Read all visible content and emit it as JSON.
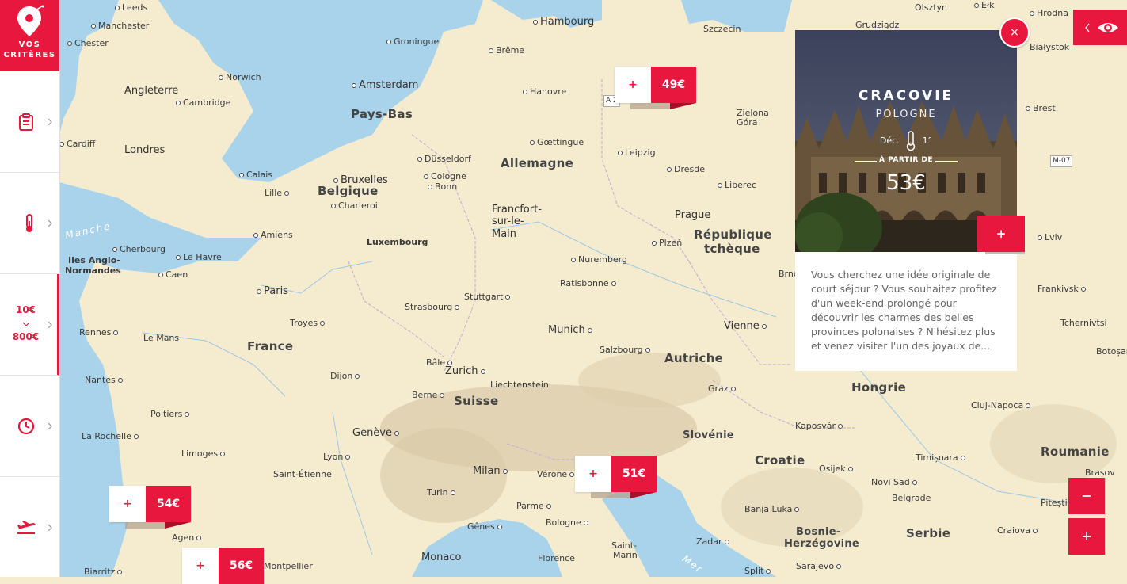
{
  "brand": {
    "line1": "VOS",
    "line2": "CRITÈRES"
  },
  "sidebar": {
    "items": [
      {
        "name": "clipboard-icon"
      },
      {
        "name": "thermometer-icon"
      },
      {
        "name": "price-range",
        "min": "10€",
        "max": "800€"
      },
      {
        "name": "clock-icon"
      },
      {
        "name": "plane-icon"
      }
    ]
  },
  "map": {
    "labels": [
      {
        "text": "Leeds",
        "type": "city"
      },
      {
        "text": "Manchester",
        "type": "city"
      },
      {
        "text": "Chester",
        "type": "city"
      },
      {
        "text": "Norwich",
        "type": "city"
      },
      {
        "text": "Angleterre",
        "type": "city-lg"
      },
      {
        "text": "Cambridge",
        "type": "city"
      },
      {
        "text": "Cardiff",
        "type": "city"
      },
      {
        "text": "Londres",
        "type": "city-lg"
      },
      {
        "text": "Calais",
        "type": "city"
      },
      {
        "text": "Lille",
        "type": "city"
      },
      {
        "text": "Manche",
        "type": "sea"
      },
      {
        "text": "Amiens",
        "type": "city"
      },
      {
        "text": "Cherbourg",
        "type": "city"
      },
      {
        "text": "Le Havre",
        "type": "city"
      },
      {
        "text": "Iles Anglo-",
        "type": "city"
      },
      {
        "text": "Normandes",
        "type": "city"
      },
      {
        "text": "Caen",
        "type": "city"
      },
      {
        "text": "Paris",
        "type": "city-lg"
      },
      {
        "text": "Rennes",
        "type": "city"
      },
      {
        "text": "Le Mans",
        "type": "city"
      },
      {
        "text": "Troyes",
        "type": "city"
      },
      {
        "text": "France",
        "type": "country"
      },
      {
        "text": "Nantes",
        "type": "city"
      },
      {
        "text": "Dijon",
        "type": "city"
      },
      {
        "text": "Poitiers",
        "type": "city"
      },
      {
        "text": "La Rochelle",
        "type": "city"
      },
      {
        "text": "Limoges",
        "type": "city"
      },
      {
        "text": "Lyon",
        "type": "city"
      },
      {
        "text": "Saint-Étienne",
        "type": "city"
      },
      {
        "text": "Agen",
        "type": "city"
      },
      {
        "text": "Biarritz",
        "type": "city"
      },
      {
        "text": "Montpellier",
        "type": "city"
      },
      {
        "text": "Groningue",
        "type": "city"
      },
      {
        "text": "Amsterdam",
        "type": "city-lg"
      },
      {
        "text": "Pays-Bas",
        "type": "country"
      },
      {
        "text": "Bruxelles",
        "type": "city-lg"
      },
      {
        "text": "Belgique",
        "type": "country"
      },
      {
        "text": "Charleroi",
        "type": "city"
      },
      {
        "text": "Luxembourg",
        "type": "city"
      },
      {
        "text": "Hambourg",
        "type": "city-lg"
      },
      {
        "text": "Brême",
        "type": "city"
      },
      {
        "text": "Hanovre",
        "type": "city"
      },
      {
        "text": "Gœttingue",
        "type": "city"
      },
      {
        "text": "Düsseldorf",
        "type": "city"
      },
      {
        "text": "Cologne",
        "type": "city"
      },
      {
        "text": "Bonn",
        "type": "city"
      },
      {
        "text": "Allemagne",
        "type": "country"
      },
      {
        "text": "Francfort-",
        "type": "city-lg"
      },
      {
        "text": "sur-le-",
        "type": "city-lg"
      },
      {
        "text": "Main",
        "type": "city-lg"
      },
      {
        "text": "Leipzig",
        "type": "city"
      },
      {
        "text": "Dresde",
        "type": "city"
      },
      {
        "text": "Nuremberg",
        "type": "city"
      },
      {
        "text": "Stuttgart",
        "type": "city"
      },
      {
        "text": "Strasbourg",
        "type": "city"
      },
      {
        "text": "Ratisbonne",
        "type": "city"
      },
      {
        "text": "Munich",
        "type": "city-lg"
      },
      {
        "text": "Salzbourg",
        "type": "city"
      },
      {
        "text": "Bâle",
        "type": "city"
      },
      {
        "text": "Zurich",
        "type": "city-lg"
      },
      {
        "text": "Liechtenstein",
        "type": "city"
      },
      {
        "text": "Berne",
        "type": "city"
      },
      {
        "text": "Suisse",
        "type": "country"
      },
      {
        "text": "Genève",
        "type": "city-lg"
      },
      {
        "text": "Milan",
        "type": "city-lg"
      },
      {
        "text": "Vérone",
        "type": "city"
      },
      {
        "text": "Turin",
        "type": "city"
      },
      {
        "text": "Parme",
        "type": "city"
      },
      {
        "text": "Bologne",
        "type": "city"
      },
      {
        "text": "Gênes",
        "type": "city"
      },
      {
        "text": "Monaco",
        "type": "city-lg"
      },
      {
        "text": "Florence",
        "type": "city"
      },
      {
        "text": "Saint-",
        "type": "city"
      },
      {
        "text": "Marin",
        "type": "city"
      },
      {
        "text": "Mer",
        "type": "sea"
      },
      {
        "text": "Szczecin",
        "type": "city"
      },
      {
        "text": "Zielona",
        "type": "city"
      },
      {
        "text": "Góra",
        "type": "city"
      },
      {
        "text": "Liberec",
        "type": "city"
      },
      {
        "text": "Prague",
        "type": "city-lg"
      },
      {
        "text": "Plzeň",
        "type": "city"
      },
      {
        "text": "République",
        "type": "country"
      },
      {
        "text": "tchèque",
        "type": "country"
      },
      {
        "text": "Brno",
        "type": "city"
      },
      {
        "text": "Vienne",
        "type": "city-lg"
      },
      {
        "text": "Autriche",
        "type": "country"
      },
      {
        "text": "Graz",
        "type": "city"
      },
      {
        "text": "Slovénie",
        "type": "country"
      },
      {
        "text": "Croatie",
        "type": "country"
      },
      {
        "text": "Zadar",
        "type": "city"
      },
      {
        "text": "Split",
        "type": "city"
      },
      {
        "text": "Banja Luka",
        "type": "city"
      },
      {
        "text": "Bosnie-",
        "type": "country"
      },
      {
        "text": "Herzégovine",
        "type": "country"
      },
      {
        "text": "Sarajevo",
        "type": "city"
      },
      {
        "text": "Hongrie",
        "type": "country"
      },
      {
        "text": "Kaposvár",
        "type": "city"
      },
      {
        "text": "Osijek",
        "type": "city"
      },
      {
        "text": "Novi Sad",
        "type": "city"
      },
      {
        "text": "Belgrade",
        "type": "city"
      },
      {
        "text": "Serbie",
        "type": "country"
      },
      {
        "text": "Timișoara",
        "type": "city"
      },
      {
        "text": "Cluj-Napoca",
        "type": "city"
      },
      {
        "text": "Roumanie",
        "type": "country"
      },
      {
        "text": "Pitești",
        "type": "city"
      },
      {
        "text": "Craiova",
        "type": "city"
      },
      {
        "text": "Brașov",
        "type": "city"
      },
      {
        "text": "Botoșani",
        "type": "city"
      },
      {
        "text": "Tchernivtsi",
        "type": "city"
      },
      {
        "text": "Frankivsk",
        "type": "city"
      },
      {
        "text": "Lviv",
        "type": "city"
      },
      {
        "text": "Brest",
        "type": "city"
      },
      {
        "text": "Białystok",
        "type": "city"
      },
      {
        "text": "Olsztyn",
        "type": "city"
      },
      {
        "text": "Ełk",
        "type": "city"
      },
      {
        "text": "Hrodna",
        "type": "city"
      },
      {
        "text": "Grudziądz",
        "type": "city"
      },
      {
        "text": "M-07",
        "type": "city"
      },
      {
        "text": "A 2",
        "type": "city"
      }
    ]
  },
  "markers": [
    {
      "price": "49€",
      "plus": "+"
    },
    {
      "price": "51€",
      "plus": "+"
    },
    {
      "price": "54€",
      "plus": "+"
    },
    {
      "price": "56€",
      "plus": "+"
    }
  ],
  "card": {
    "city": "CRACOVIE",
    "country": "POLOGNE",
    "month": "Déc.",
    "temp": "1°",
    "from_label": "À PARTIR DE",
    "price": "53€",
    "add": "+",
    "description": "Vous cherchez une idée originale de court séjour ? Vous souhaitez profitez d'un week-end prolongé pour découvrir les charmes des belles provinces polonaises ? N'hésitez plus et venez visiter l'un des joyaux de..."
  },
  "close": "×",
  "zoom": {
    "minus": "−",
    "plus": "+"
  },
  "colors": {
    "accent": "#e8173d",
    "sea": "#a9d3ea",
    "land": "#f5ecd0"
  }
}
